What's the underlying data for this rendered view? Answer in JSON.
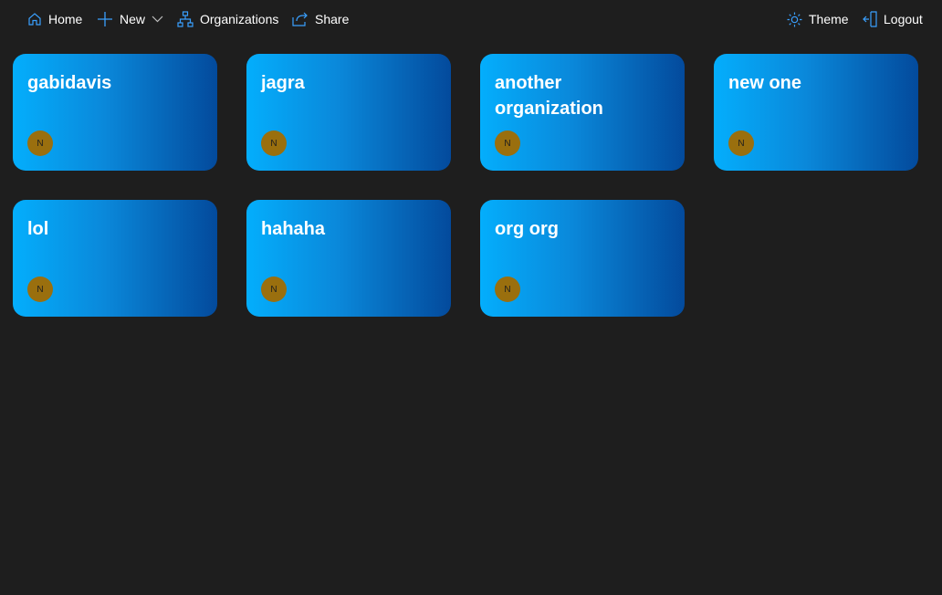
{
  "nav": {
    "home_label": "Home",
    "new_label": "New",
    "organizations_label": "Organizations",
    "share_label": "Share",
    "theme_label": "Theme",
    "logout_label": "Logout",
    "icons": [
      "home-icon",
      "plus-icon",
      "chevron-down-icon",
      "org-chart-icon",
      "share-icon",
      "sun-icon",
      "logout-icon"
    ],
    "icon_color": "#3aa0ff"
  },
  "organizations": [
    {
      "name": "gabidavis",
      "avatar_initial": "N"
    },
    {
      "name": "jagra",
      "avatar_initial": "N"
    },
    {
      "name": "another organization",
      "avatar_initial": "N"
    },
    {
      "name": "new one",
      "avatar_initial": "N"
    },
    {
      "name": "lol",
      "avatar_initial": "N"
    },
    {
      "name": "hahaha",
      "avatar_initial": "N"
    },
    {
      "name": "org org",
      "avatar_initial": "N"
    }
  ],
  "colors": {
    "background": "#1e1e1e",
    "card_gradient_start": "#04aefc",
    "card_gradient_end": "#034a9c",
    "avatar": "#9a6f0e"
  }
}
